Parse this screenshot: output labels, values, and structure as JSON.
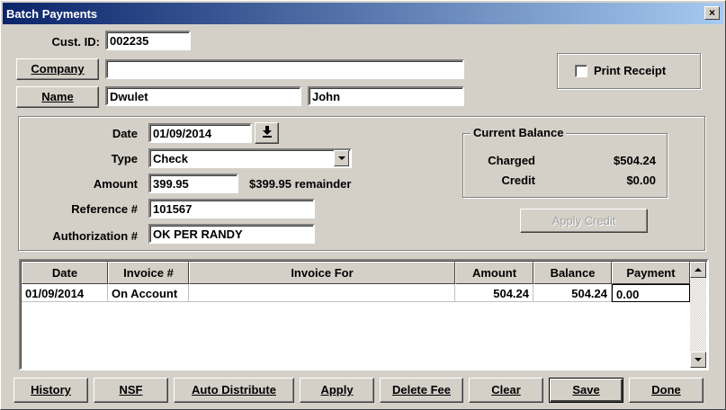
{
  "window": {
    "title": "Batch Payments",
    "close_label": "×"
  },
  "customer": {
    "cust_id_label": "Cust. ID:",
    "cust_id": "002235",
    "company_button": "Company",
    "company": "",
    "name_button": "Name",
    "last_name": "Dwulet",
    "first_name": "John"
  },
  "print_receipt": {
    "label": "Print Receipt",
    "checked": false
  },
  "payment": {
    "date_label": "Date",
    "date": "01/09/2014",
    "type_label": "Type",
    "type": "Check",
    "amount_label": "Amount",
    "amount": "399.95",
    "remainder": "$399.95 remainder",
    "reference_label": "Reference #",
    "reference": "101567",
    "authorization_label": "Authorization #",
    "authorization": "OK PER RANDY"
  },
  "balance": {
    "title": "Current Balance",
    "charged_label": "Charged",
    "charged": "$504.24",
    "credit_label": "Credit",
    "credit": "$0.00",
    "apply_credit_button": "Apply Credit"
  },
  "table": {
    "headers": [
      "Date",
      "Invoice #",
      "Invoice For",
      "Amount",
      "Balance",
      "Payment"
    ],
    "rows": [
      {
        "date": "01/09/2014",
        "invoice": "On Account",
        "invoice_for": "",
        "amount": "504.24",
        "balance": "504.24",
        "payment": "0.00"
      }
    ]
  },
  "buttons": {
    "history": "History",
    "nsf": "NSF",
    "auto_distribute": "Auto Distribute",
    "apply": "Apply",
    "delete_fee": "Delete Fee",
    "clear": "Clear",
    "save": "Save",
    "done": "Done"
  }
}
